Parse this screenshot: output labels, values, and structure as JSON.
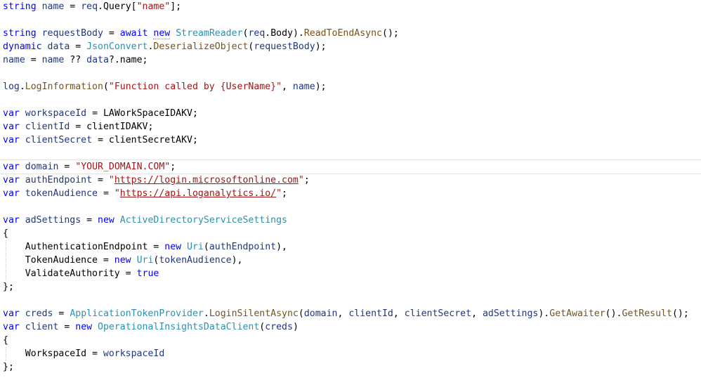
{
  "editor": {
    "lines": [
      [
        {
          "t": "string",
          "c": "kw"
        },
        {
          "t": " "
        },
        {
          "t": "name",
          "c": "loc"
        },
        {
          "t": " = "
        },
        {
          "t": "req",
          "c": "prm"
        },
        {
          "t": ".Query["
        },
        {
          "t": "\"name\"",
          "c": "str"
        },
        {
          "t": "];"
        }
      ],
      [],
      [
        {
          "t": "string",
          "c": "kw"
        },
        {
          "t": " "
        },
        {
          "t": "requestBody",
          "c": "loc"
        },
        {
          "t": " = "
        },
        {
          "t": "await",
          "c": "kw"
        },
        {
          "t": " "
        },
        {
          "t": "new",
          "c": "kw squiggle"
        },
        {
          "t": " "
        },
        {
          "t": "StreamReader",
          "c": "typ"
        },
        {
          "t": "("
        },
        {
          "t": "req",
          "c": "prm"
        },
        {
          "t": ".Body)."
        },
        {
          "t": "ReadToEndAsync",
          "c": "mth"
        },
        {
          "t": "();"
        }
      ],
      [
        {
          "t": "dynamic",
          "c": "kw"
        },
        {
          "t": " "
        },
        {
          "t": "data",
          "c": "loc"
        },
        {
          "t": " = "
        },
        {
          "t": "JsonConvert",
          "c": "typ"
        },
        {
          "t": "."
        },
        {
          "t": "DeserializeObject",
          "c": "mth"
        },
        {
          "t": "("
        },
        {
          "t": "requestBody",
          "c": "loc"
        },
        {
          "t": ");"
        }
      ],
      [
        {
          "t": "name",
          "c": "loc"
        },
        {
          "t": " = "
        },
        {
          "t": "name",
          "c": "loc"
        },
        {
          "t": " ?? "
        },
        {
          "t": "data",
          "c": "loc"
        },
        {
          "t": "?.name;"
        }
      ],
      [],
      [
        {
          "t": "log",
          "c": "prm"
        },
        {
          "t": "."
        },
        {
          "t": "LogInformation",
          "c": "mth"
        },
        {
          "t": "("
        },
        {
          "t": "\"Function called by {UserName}\"",
          "c": "str"
        },
        {
          "t": ", "
        },
        {
          "t": "name",
          "c": "loc"
        },
        {
          "t": ");"
        }
      ],
      [],
      [
        {
          "t": "var",
          "c": "kw"
        },
        {
          "t": " "
        },
        {
          "t": "workspaceId",
          "c": "loc"
        },
        {
          "t": " = LAWorkSpaceIDAKV;"
        }
      ],
      [
        {
          "t": "var",
          "c": "kw"
        },
        {
          "t": " "
        },
        {
          "t": "clientId",
          "c": "loc"
        },
        {
          "t": " = clientIDAKV;"
        }
      ],
      [
        {
          "t": "var",
          "c": "kw"
        },
        {
          "t": " "
        },
        {
          "t": "clientSecret",
          "c": "loc"
        },
        {
          "t": " = clientSecretAKV;"
        }
      ],
      [],
      [
        {
          "t": "var",
          "c": "kw"
        },
        {
          "t": " "
        },
        {
          "t": "domain",
          "c": "loc"
        },
        {
          "t": " = "
        },
        {
          "t": "\"YOUR_DOMAIN.COM\"",
          "c": "str"
        },
        {
          "t": ";"
        }
      ],
      [
        {
          "t": "var",
          "c": "kw"
        },
        {
          "t": " "
        },
        {
          "t": "authEndpoint",
          "c": "loc"
        },
        {
          "t": " = "
        },
        {
          "t": "\"",
          "c": "str"
        },
        {
          "t": "https://login.microsoftonline.com",
          "c": "url"
        },
        {
          "t": "\"",
          "c": "str"
        },
        {
          "t": ";"
        }
      ],
      [
        {
          "t": "var",
          "c": "kw"
        },
        {
          "t": " "
        },
        {
          "t": "tokenAudience",
          "c": "loc"
        },
        {
          "t": " = "
        },
        {
          "t": "\"",
          "c": "str"
        },
        {
          "t": "https://api.loganalytics.io/",
          "c": "url"
        },
        {
          "t": "\"",
          "c": "str"
        },
        {
          "t": ";"
        }
      ],
      [],
      [
        {
          "t": "var",
          "c": "kw"
        },
        {
          "t": " "
        },
        {
          "t": "adSettings",
          "c": "loc"
        },
        {
          "t": " = "
        },
        {
          "t": "new",
          "c": "kw"
        },
        {
          "t": " "
        },
        {
          "t": "ActiveDirectoryServiceSettings",
          "c": "typ"
        }
      ],
      [
        {
          "t": "{"
        }
      ],
      [
        {
          "t": "    AuthenticationEndpoint = "
        },
        {
          "t": "new",
          "c": "kw"
        },
        {
          "t": " "
        },
        {
          "t": "Uri",
          "c": "typ"
        },
        {
          "t": "("
        },
        {
          "t": "authEndpoint",
          "c": "loc"
        },
        {
          "t": "),"
        }
      ],
      [
        {
          "t": "    TokenAudience = "
        },
        {
          "t": "new",
          "c": "kw"
        },
        {
          "t": " "
        },
        {
          "t": "Uri",
          "c": "typ"
        },
        {
          "t": "("
        },
        {
          "t": "tokenAudience",
          "c": "loc"
        },
        {
          "t": "),"
        }
      ],
      [
        {
          "t": "    ValidateAuthority = "
        },
        {
          "t": "true",
          "c": "kw"
        }
      ],
      [
        {
          "t": "};"
        }
      ],
      [],
      [
        {
          "t": "var",
          "c": "kw"
        },
        {
          "t": " "
        },
        {
          "t": "creds",
          "c": "loc"
        },
        {
          "t": " = "
        },
        {
          "t": "ApplicationTokenProvider",
          "c": "typ"
        },
        {
          "t": "."
        },
        {
          "t": "LoginSilentAsync",
          "c": "mth"
        },
        {
          "t": "("
        },
        {
          "t": "domain",
          "c": "loc"
        },
        {
          "t": ", "
        },
        {
          "t": "clientId",
          "c": "loc"
        },
        {
          "t": ", "
        },
        {
          "t": "clientSecret",
          "c": "loc"
        },
        {
          "t": ", "
        },
        {
          "t": "adSettings",
          "c": "loc"
        },
        {
          "t": ")."
        },
        {
          "t": "GetAwaiter",
          "c": "mth"
        },
        {
          "t": "()."
        },
        {
          "t": "GetResult",
          "c": "mth"
        },
        {
          "t": "();"
        }
      ],
      [
        {
          "t": "var",
          "c": "kw"
        },
        {
          "t": " "
        },
        {
          "t": "client",
          "c": "loc"
        },
        {
          "t": " = "
        },
        {
          "t": "new",
          "c": "kw"
        },
        {
          "t": " "
        },
        {
          "t": "OperationalInsightsDataClient",
          "c": "typ"
        },
        {
          "t": "("
        },
        {
          "t": "creds",
          "c": "loc"
        },
        {
          "t": ")"
        }
      ],
      [
        {
          "t": "{"
        }
      ],
      [
        {
          "t": "    WorkspaceId = "
        },
        {
          "t": "workspaceId",
          "c": "loc"
        }
      ],
      [
        {
          "t": "};"
        }
      ]
    ]
  }
}
